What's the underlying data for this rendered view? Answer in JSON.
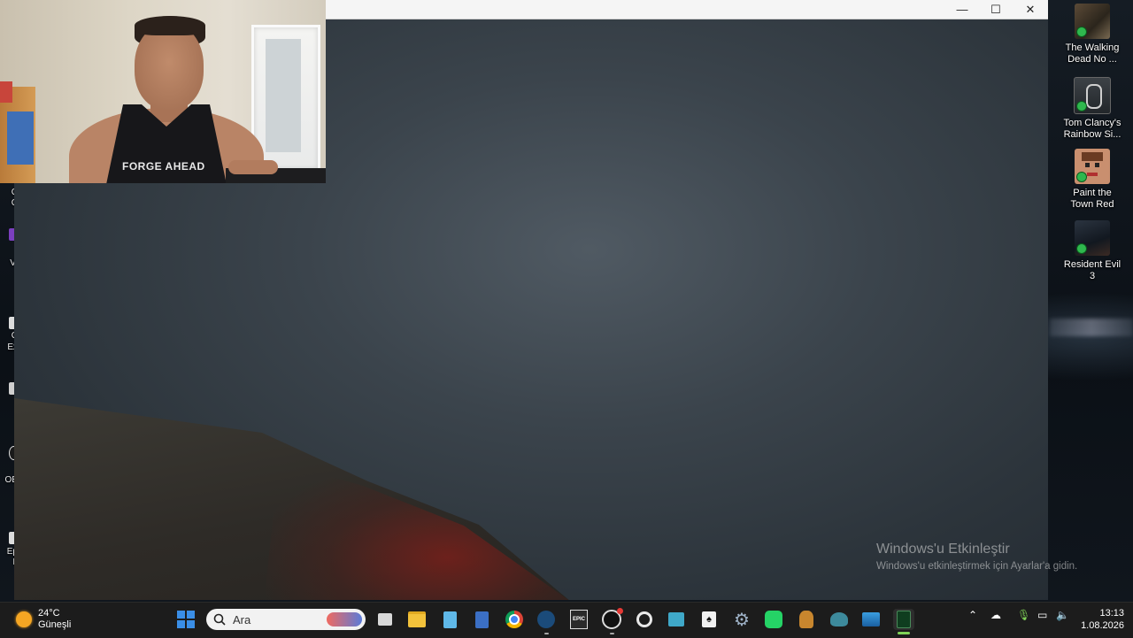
{
  "window": {
    "minimize_glyph": "—",
    "maximize_glyph": "☐",
    "close_glyph": "✕"
  },
  "webcam": {
    "shirt_text": "FORGE AHEAD"
  },
  "activation": {
    "title": "Windows'u Etkinleştir",
    "subtitle": "Windows'u etkinleştirmek için Ayarlar'a gidin."
  },
  "desktop_icons_right": [
    {
      "label_line1": "The Walking",
      "label_line2": "Dead No ..."
    },
    {
      "label_line1": "Tom Clancy's",
      "label_line2": "Rainbow Si..."
    },
    {
      "label_line1": "Paint the",
      "label_line2": "Town Red"
    },
    {
      "label_line1": "Resident Evil",
      "label_line2": "3"
    }
  ],
  "desktop_icons_left_clipped": [
    {
      "label": "C"
    },
    {
      "label": "Vi"
    },
    {
      "label": "C"
    },
    {
      "label": "Ex"
    },
    {
      "label": "OE"
    },
    {
      "label": "Ep"
    },
    {
      "label": "L"
    }
  ],
  "taskbar": {
    "weather_temp": "24°C",
    "weather_desc": "Güneşli",
    "search_placeholder": "Ara",
    "epic_label": "EPIC",
    "time": "13:13",
    "date": "1.08.2026"
  },
  "colors": {
    "taskbar_bg": "#1c1c1c",
    "windows_blue": "#3a8ee6",
    "green_status": "#2fb84e",
    "active_app_green": "#7fd257"
  }
}
